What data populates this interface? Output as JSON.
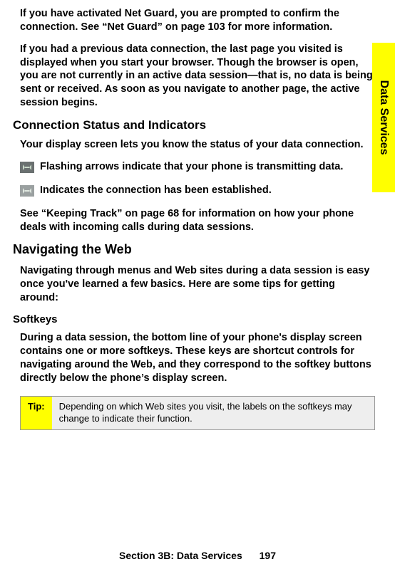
{
  "sideTab": "Data Services",
  "para1": "If you have activated Net Guard, you are prompted to confirm the connection. See “Net Guard” on page 103 for more information.",
  "para2": "If you had a previous data connection, the last page you visited is displayed when you start your browser. Though the browser is open, you are not currently in an active data session—that is, no data is being sent or received. As soon as you navigate to another page, the active session begins.",
  "h1": "Connection Status and Indicators",
  "para3": "Your display screen lets you know the status of your data connection.",
  "iconText1": "Flashing arrows indicate that your phone is transmitting data.",
  "iconText2": "Indicates the connection has been established.",
  "para4": "See “Keeping Track” on page 68 for information on how your phone deals with incoming calls during data sessions.",
  "h2": "Navigating the Web",
  "para5": "Navigating through menus and Web sites during a data session is easy once you've learned a few basics. Here are some tips for getting around:",
  "h3": "Softkeys",
  "para6": "During a data session, the bottom line of your phone's display screen contains one or more softkeys. These keys are shortcut controls for navigating around the Web, and they correspond to the softkey buttons directly below the phone’s display screen.",
  "tipLabel": "Tip:",
  "tipContent": "Depending on which Web sites you visit, the labels on the softkeys may change to indicate their function.",
  "footerSection": "Section 3B: Data Services",
  "footerPage": "197"
}
